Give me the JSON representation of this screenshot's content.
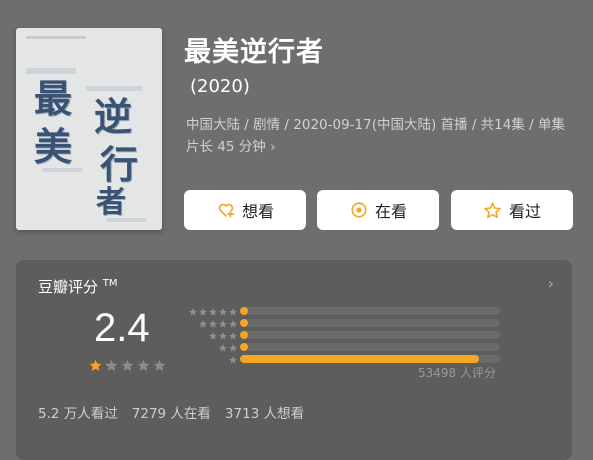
{
  "title": "最美逆行者",
  "year": "(2020)",
  "meta_line": "中国大陆 / 剧情 / 2020-09-17(中国大陆) 首播 / 共14集 / 单集片长 45 分钟",
  "meta_chevron": "›",
  "poster": {
    "chars": [
      "最",
      "美",
      "逆",
      "行",
      "者"
    ],
    "tagline": "最美逆行者"
  },
  "buttons": {
    "want": "想看",
    "doing": "在看",
    "done": "看过"
  },
  "rating": {
    "title": "豆瓣评分",
    "tm": "TM",
    "chevron": "›",
    "score": "2.4",
    "stars_filled_fraction": 0.24,
    "distribution": [
      {
        "stars": 5,
        "fraction": 0.02
      },
      {
        "stars": 4,
        "fraction": 0.02
      },
      {
        "stars": 3,
        "fraction": 0.02
      },
      {
        "stars": 2,
        "fraction": 0.02
      },
      {
        "stars": 1,
        "fraction": 0.92
      }
    ],
    "count_text": "53498 人评分"
  },
  "stats": {
    "watched": "5.2 万人看过",
    "watching": "7279 人在看",
    "want": "3713 人想看"
  },
  "colors": {
    "accent": "#f5a623",
    "background": "#6f6e6c",
    "panel": "#5e5d5b"
  }
}
